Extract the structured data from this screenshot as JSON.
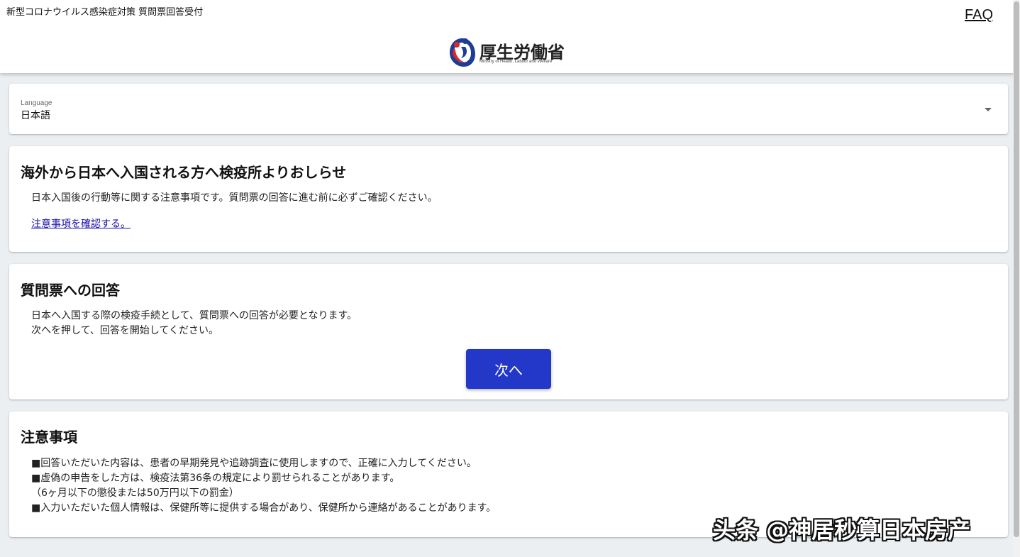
{
  "header": {
    "app_title": "新型コロナウイルス感染症対策 質問票回答受付",
    "faq_label": "FAQ",
    "logo_name": "厚生労働省",
    "logo_subtitle": "Ministry of Health, Labour and Welfare"
  },
  "language": {
    "label": "Language",
    "selected": "日本語"
  },
  "notice": {
    "title": "海外から日本へ入国される方へ検疫所よりおしらせ",
    "description": "日本入国後の行動等に関する注意事項です。質問票の回答に進む前に必ずご確認ください。",
    "link": "注意事項を確認する。"
  },
  "questionnaire": {
    "title": "質問票への回答",
    "line1": "日本へ入国する際の検疫手続として、質問票への回答が必要となります。",
    "line2": "次へを押して、回答を開始してください。",
    "next_label": "次へ"
  },
  "cautions": {
    "title": "注意事項",
    "items": [
      "■回答いただいた内容は、患者の早期発見や追跡調査に使用しますので、正確に入力してください。",
      "■虚偽の申告をした方は、検疫法第36条の規定により罰せられることがあります。",
      "（6ヶ月以下の懲役または50万円以下の罰金）",
      "■入力いただいた個人情報は、保健所等に提供する場合があり、保健所から連絡があることがあります。"
    ]
  },
  "watermark": "头条 @神居秒算日本房产",
  "colors": {
    "primary_button": "#2338c8",
    "link": "#1a0dab",
    "background": "#eceff1",
    "logo_red": "#d7262c",
    "logo_blue": "#1f3c94"
  },
  "icons": {
    "logo": "mhlw-logo-icon",
    "dropdown": "dropdown-arrow-icon"
  }
}
